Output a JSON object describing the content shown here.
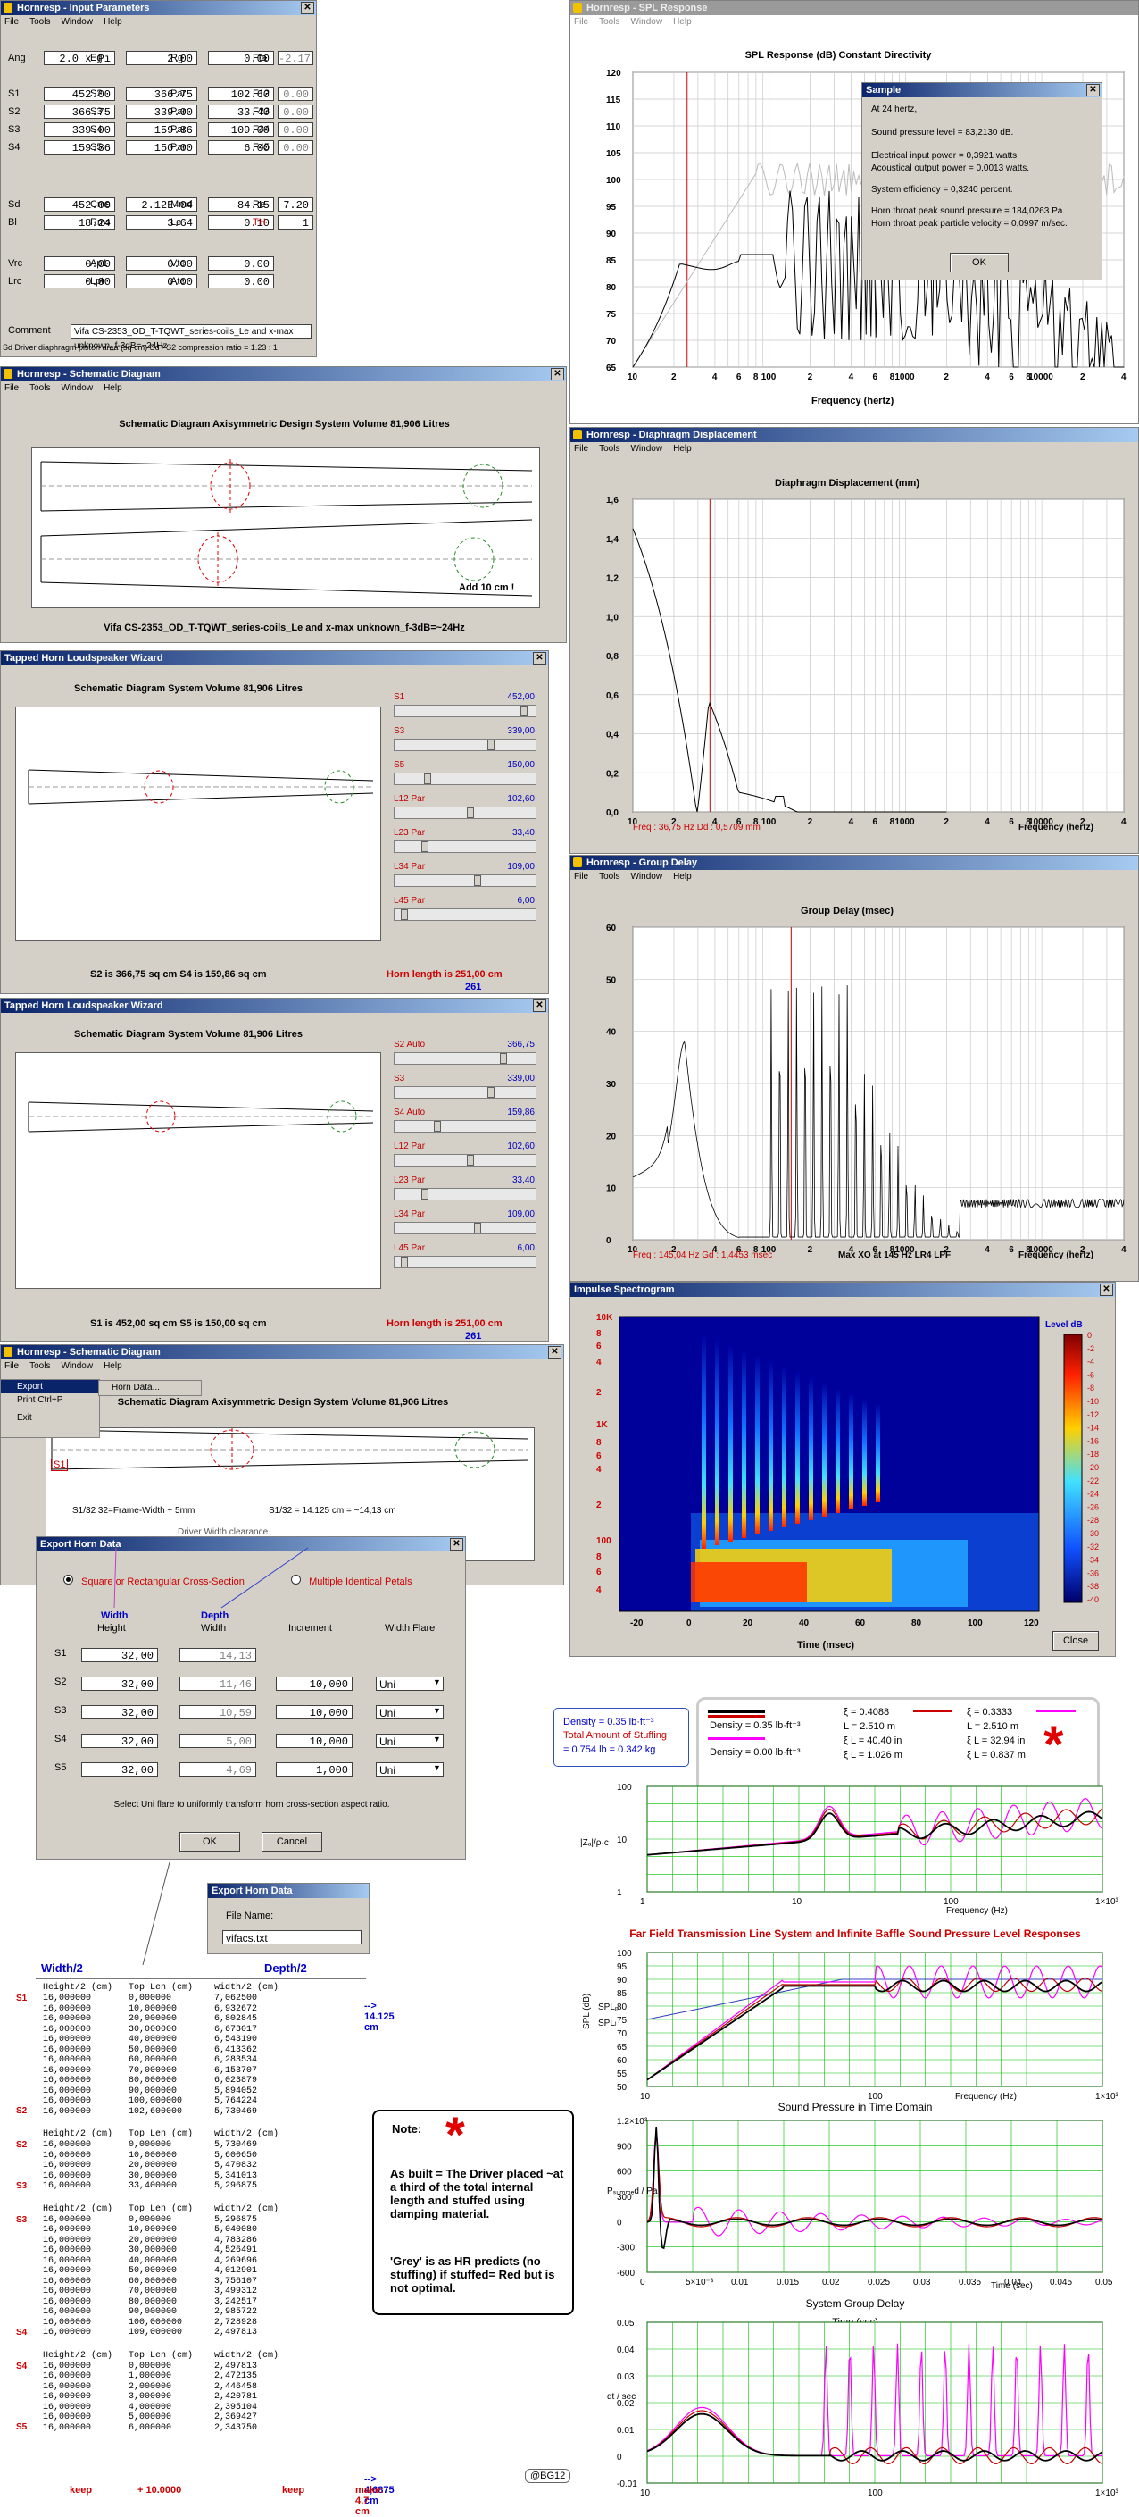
{
  "input_params": {
    "title": "Hornresp - Input Parameters",
    "menu": [
      "File",
      "Tools",
      "Window",
      "Help"
    ],
    "rows": [
      [
        [
          "Ang",
          "2.0 x Pi"
        ],
        [
          "Eg",
          "2.00"
        ],
        [
          "Rg",
          "0.00"
        ],
        [
          "Fta",
          "-2.17"
        ]
      ],
      [
        [
          "S1",
          "452.00"
        ],
        [
          "S2",
          "366.75"
        ],
        [
          "Par",
          "102.60"
        ],
        [
          "F12",
          "0.00"
        ]
      ],
      [
        [
          "S2",
          "366.75"
        ],
        [
          "S3",
          "339.00"
        ],
        [
          "Par",
          "33.40"
        ],
        [
          "F23",
          "0.00"
        ]
      ],
      [
        [
          "S3",
          "339.00"
        ],
        [
          "S4",
          "159.86"
        ],
        [
          "Par",
          "109.00"
        ],
        [
          "F34",
          "0.00"
        ]
      ],
      [
        [
          "S4",
          "159.86"
        ],
        [
          "S5",
          "150.00"
        ],
        [
          "Par",
          "6.00"
        ],
        [
          "F45",
          "0.00"
        ]
      ],
      [
        [
          "Sd",
          "452.00"
        ],
        [
          "Cms",
          "2.12E-04"
        ],
        [
          "Mmd",
          "84.15"
        ],
        [
          "Re",
          "7.20"
        ]
      ],
      [
        [
          "Bl",
          "18.24"
        ],
        [
          "Rms",
          "3.64"
        ],
        [
          "Le",
          "0.10"
        ],
        [
          "TH",
          "1"
        ]
      ],
      [
        [
          "Vrc",
          "0.00"
        ],
        [
          "Ap1",
          "0.00"
        ],
        [
          "Vtc",
          "0.00"
        ],
        [
          "",
          ""
        ]
      ],
      [
        [
          "Lrc",
          "0.00"
        ],
        [
          "Lpt",
          "0.00"
        ],
        [
          "Atc",
          "0.00"
        ],
        [
          "",
          ""
        ]
      ]
    ],
    "comment_label": "Comment",
    "comment": "Vifa CS-2353_OD_T-TQWT_series-coils_Le and x-max unknown_f-3dB=~24Hz",
    "status": "Sd  Driver diaphragm piston area (sq cm)   Sd / S2 compression ratio = 1.23 : 1"
  },
  "spl": {
    "title": "Hornresp - SPL Response",
    "menu": [
      "File",
      "Tools",
      "Window",
      "Help"
    ],
    "chart_title": "SPL Response (dB)    Constant Directivity",
    "xlabel": "Frequency (hertz)",
    "yticks": [
      "120",
      "115",
      "110",
      "105",
      "100",
      "95",
      "90",
      "85",
      "80",
      "75",
      "70",
      "65"
    ],
    "xticks": [
      "10",
      "2",
      "4",
      "6",
      "8",
      "100",
      "2",
      "4",
      "6",
      "8",
      "1000",
      "2",
      "4",
      "6",
      "8",
      "10000",
      "2",
      "4"
    ]
  },
  "sample": {
    "title": "Sample",
    "lines": [
      "At 24 hertz,",
      "Sound pressure level = 83,2130 dB.",
      "Electrical input power = 0,3921 watts.",
      "Acoustical output power = 0,0013 watts.",
      "System efficiency = 0,3240 percent.",
      "Horn throat peak sound pressure = 184,0263 Pa.",
      "Horn throat peak particle velocity = 0,0997 m/sec."
    ],
    "ok": "OK"
  },
  "schem1": {
    "title": "Hornresp - Schematic Diagram",
    "menu": [
      "File",
      "Tools",
      "Window",
      "Help"
    ],
    "heading": "Schematic Diagram   Axisymmetric Design   System Volume 81,906 Litres",
    "note": "Add 10 cm !",
    "caption": "Vifa CS-2353_OD_T-TQWT_series-coils_Le and x-max unknown_f-3dB=~24Hz"
  },
  "diaphragm": {
    "title": "Hornresp - Diaphragm Displacement",
    "menu": [
      "File",
      "Tools",
      "Window",
      "Help"
    ],
    "chart_title": "Diaphragm Displacement (mm)",
    "yticks": [
      "1,6",
      "1,4",
      "1,2",
      "1,0",
      "0,8",
      "0,6",
      "0,4",
      "0,2",
      "0,0"
    ],
    "xticks": [
      "10",
      "2",
      "4",
      "6",
      "8",
      "100",
      "2",
      "4",
      "6",
      "8",
      "1000",
      "2",
      "4",
      "6",
      "8",
      "10000",
      "2",
      "4"
    ],
    "status": "Freq : 36,75 Hz    Dd : 0,5709 mm",
    "xlabel": "Frequency (hertz)"
  },
  "wizard1": {
    "title": "Tapped Horn Loudspeaker Wizard",
    "heading": "Schematic Diagram   System Volume 81,906 Litres",
    "sliders": [
      [
        "S1",
        "452,00",
        0.95
      ],
      [
        "S3",
        "339,00",
        0.7
      ],
      [
        "S5",
        "150,00",
        0.22
      ],
      [
        "L12 Par",
        "102,60",
        0.55
      ],
      [
        "L23 Par",
        "33,40",
        0.2
      ],
      [
        "L34 Par",
        "109,00",
        0.6
      ],
      [
        "L45 Par",
        "6,00",
        0.05
      ]
    ],
    "foot1": "S2 is 366,75 sq cm    S4 is 159,86 sq cm",
    "horn": "Horn length is 251,00 cm",
    "horn_num": "261"
  },
  "wizard2": {
    "title": "Tapped Horn Loudspeaker Wizard",
    "heading": "Schematic Diagram   System Volume 81,906 Litres",
    "sliders": [
      [
        "S2 Auto",
        "366,75",
        0.8
      ],
      [
        "S3",
        "339,00",
        0.7
      ],
      [
        "S4 Auto",
        "159,86",
        0.3
      ],
      [
        "L12 Par",
        "102,60",
        0.55
      ],
      [
        "L23 Par",
        "33,40",
        0.2
      ],
      [
        "L34 Par",
        "109,00",
        0.6
      ],
      [
        "L45 Par",
        "6,00",
        0.05
      ]
    ],
    "foot1": "S1 is 452,00 sq cm    S5 is 150,00 sq cm",
    "horn": "Horn length is 251,00 cm",
    "horn_num": "261"
  },
  "group": {
    "title": "Hornresp - Group Delay",
    "menu": [
      "File",
      "Tools",
      "Window",
      "Help"
    ],
    "chart_title": "Group Delay (msec)",
    "yticks": [
      "60",
      "50",
      "40",
      "30",
      "20",
      "10",
      "0"
    ],
    "xticks": [
      "10",
      "2",
      "4",
      "6",
      "8",
      "100",
      "2",
      "4",
      "6",
      "8",
      "1000",
      "2",
      "4",
      "6",
      "8",
      "10000",
      "2",
      "4"
    ],
    "status": "Freq : 145,04 Hz    Gd : 1,4453 msec",
    "xo": "Max XO at 145 Hz LR4 LPF",
    "xlabel": "Frequency (hertz)"
  },
  "impulse": {
    "title": "Impulse Spectrogram",
    "yticks": [
      "10K",
      "8",
      "6",
      "4",
      "2",
      "1K",
      "8",
      "6",
      "4",
      "2",
      "100",
      "8",
      "6",
      "4"
    ],
    "xticks": [
      "-20",
      "0",
      "20",
      "40",
      "60",
      "80",
      "100",
      "120"
    ],
    "xlabel": "Time (msec)",
    "level": "Level  dB",
    "levels": [
      "0",
      "-2",
      "-4",
      "-6",
      "-8",
      "-10",
      "-12",
      "-14",
      "-16",
      "-18",
      "-20",
      "-22",
      "-24",
      "-26",
      "-28",
      "-30",
      "-32",
      "-34",
      "-36",
      "-38",
      "-40"
    ],
    "close": "Close"
  },
  "schem2": {
    "title": "Hornresp - Schematic Diagram",
    "menu": [
      "File",
      "Tools",
      "Window",
      "Help"
    ],
    "dropdown": [
      "Export",
      "Print   Ctrl+P",
      "Exit"
    ],
    "submenu": "Horn Data...",
    "heading": "Schematic Diagram   Axisymmetric Design   System Volume 81,906 Litres",
    "s1": "S1",
    "annot1": "S1/32  32=Frame-Width + 5mm",
    "annot2": "S1/32 = 14.125 cm  = ~14,13 cm",
    "annot3": "Driver Width clearance"
  },
  "export": {
    "title": "Export Horn Data",
    "radio1": "Square or Rectangular Cross-Section",
    "radio2": "Multiple Identical Petals",
    "col_width": "Width",
    "col_height": "Height",
    "col_depth": "Depth",
    "col_width2": "Width",
    "col_inc": "Increment",
    "col_flare": "Width Flare",
    "rows": [
      [
        "S1",
        "32,00",
        "14,13",
        "",
        ""
      ],
      [
        "S2",
        "32,00",
        "11,46",
        "10,000",
        "Uni"
      ],
      [
        "S3",
        "32,00",
        "10,59",
        "10,000",
        "Uni"
      ],
      [
        "S4",
        "32,00",
        "5,00",
        "10,000",
        "Uni"
      ],
      [
        "S5",
        "32,00",
        "4,69",
        "1,000",
        "Uni"
      ]
    ],
    "hint": "Select Uni flare to uniformly transform horn cross-section aspect ratio.",
    "ok": "OK",
    "cancel": "Cancel"
  },
  "export2": {
    "title": "Export Horn Data",
    "file_label": "File Name:",
    "file": "vifacs.txt"
  },
  "table": {
    "head_w": "Width/2",
    "head_d": "Depth/2",
    "s1_note": "--> 14.125 cm",
    "blocks": [
      {
        "lbl": "S1",
        "hdr": "Height/2 (cm)   Top Len (cm)    width/2 (cm)",
        "rows": [
          "16,000000       0,000000        7,062500",
          "16,000000       10,000000       6,932672",
          "16,000000       20,000000       6,802845",
          "16,000000       30,000000       6,673017",
          "16,000000       40,000000       6,543190",
          "16,000000       50,000000       6,413362",
          "16,000000       60,000000       6,283534",
          "16,000000       70,000000       6,153707",
          "16,000000       80,000000       6,023879",
          "16,000000       90,000000       5,894052",
          "16,000000       100,000000      5,764224",
          "16,000000       102,600000      5,730469"
        ],
        "end": "S2"
      },
      {
        "lbl": "S2",
        "hdr": "Height/2 (cm)   Top Len (cm)    width/2 (cm)",
        "rows": [
          "16,000000       0,000000        5,730469",
          "16,000000       10,000000       5,600650",
          "16,000000       20,000000       5,470832",
          "16,000000       30,000000       5,341013",
          "16,000000       33,400000       5,296875"
        ],
        "end": "S3"
      },
      {
        "lbl": "S3",
        "hdr": "Height/2 (cm)   Top Len (cm)    width/2 (cm)",
        "rows": [
          "16,000000       0,000000        5,296875",
          "16,000000       10,000000       5,040080",
          "16,000000       20,000000       4,783286",
          "16,000000       30,000000       4,526491",
          "16,000000       40,000000       4,269696",
          "16,000000       50,000000       4,012901",
          "16,000000       60,000000       3,756107",
          "16,000000       70,000000       3,499312",
          "16,000000       80,000000       3,242517",
          "16,000000       90,000000       2,985722",
          "16,000000       100,000000      2,728928",
          "16,000000       109,000000      2,497813"
        ],
        "end": "S4"
      },
      {
        "lbl": "S4",
        "hdr": "Height/2 (cm)   Top Len (cm)    width/2 (cm)",
        "rows": [
          "16,000000       0,000000        2,497813",
          "16,000000       1,000000        2,472135",
          "16,000000       2,000000        2,446458",
          "16,000000       3,000000        2,420781",
          "16,000000       4,000000        2,395104",
          "16,000000       5,000000        2,369427",
          "16,000000       6,000000        2,343750"
        ],
        "end": "S5"
      }
    ],
    "s5_note": "--> 4,6875 cm",
    "keep1": "keep",
    "plus": "+ 10.0000",
    "keep2": "keep",
    "make": "make: 4.7 cm"
  },
  "note": {
    "title": "Note:",
    "p1": "As built = The Driver placed ~at a third of the total internal length and stuffed using damping material.",
    "p2": "'Grey' is as HR predicts (no stuffing) if stuffed= Red but is not optimal."
  },
  "badge": "@BG12",
  "density": {
    "line1": "Density = 0.35 lb·ft⁻³",
    "line2": "Total Amount of Stuffing",
    "line3": "= 0.754 lb = 0.342 kg"
  },
  "legend": {
    "e1": "Density = 0.35 lb·ft⁻³",
    "e2": "Density = 0.00 lb·ft⁻³",
    "c1": [
      "ξ = 0.4088",
      "L = 2.510 m",
      "ξ L = 40.40 in",
      "ξ L = 1.026 m"
    ],
    "c2": [
      "ξ = 0.3333",
      "L = 2.510 m",
      "ξ L = 32.94 in",
      "ξ L = 0.837 m"
    ]
  },
  "math1": {
    "ylabel": "|Zₐ|/ρ·c",
    "yticks": [
      "100",
      "10",
      "1"
    ],
    "xticks": [
      "1",
      "10",
      "100",
      "1×10³"
    ],
    "xlabel": "Frequency (Hz)"
  },
  "math2": {
    "title": "Far Field Transmission Line System and Infinite Baffle Sound Pressure Level Responses",
    "ylabel": "SPL (dB)",
    "yticks": [
      "100",
      "95",
      "90",
      "85",
      "80",
      "75",
      "70",
      "65",
      "60",
      "55",
      "50"
    ],
    "xticks": [
      "10",
      "100",
      "1×10³"
    ],
    "xlabel": "Frequency (Hz)",
    "lbl1": "SPLₚ",
    "lbl2": "SPLₗ"
  },
  "math3": {
    "title": "Sound Pressure in Time Domain",
    "ylabel": "Pₛᵤₘₘₑd / Pa",
    "yticks": [
      "1.2×10³",
      "900",
      "600",
      "300",
      "0",
      "-300",
      "-600"
    ],
    "xticks": [
      "0",
      "5×10⁻³",
      "0.01",
      "0.015",
      "0.02",
      "0.025",
      "0.03",
      "0.035",
      "0.04",
      "0.045",
      "0.05"
    ],
    "xlabel": "Time (sec)"
  },
  "math4": {
    "title": "System Group Delay",
    "sub": "Time (sec)",
    "ylabel": "dt / sec",
    "yticks": [
      "0.05",
      "0.04",
      "0.03",
      "0.02",
      "0.01",
      "0",
      "-0.01"
    ],
    "xticks": [
      "10",
      "100",
      "1×10³"
    ]
  }
}
